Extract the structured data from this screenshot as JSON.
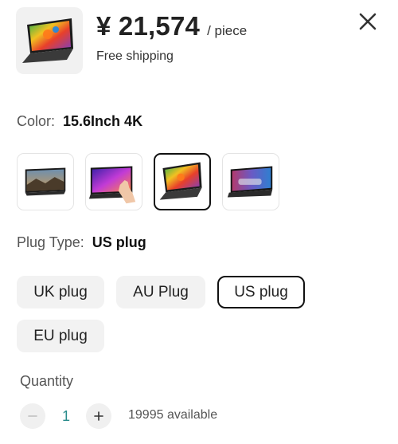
{
  "product": {
    "price": "¥ 21,574",
    "price_unit": "/ piece",
    "shipping": "Free shipping"
  },
  "color_option": {
    "label": "Color:",
    "selected_value": "15.6Inch 4K",
    "swatches": [
      {
        "name": "monitor-game-landscape"
      },
      {
        "name": "monitor-touch-hand"
      },
      {
        "name": "monitor-colorful-parrot"
      },
      {
        "name": "monitor-car-dashboard"
      }
    ],
    "selected_index": 2
  },
  "plug_option": {
    "label": "Plug Type:",
    "selected_value": "US plug",
    "choices": [
      "UK plug",
      "AU Plug",
      "US plug",
      "EU plug"
    ],
    "selected_index": 2
  },
  "quantity": {
    "label": "Quantity",
    "value": "1",
    "available": "19995 available"
  },
  "icons": {
    "close": "close-icon",
    "minus": "minus-icon",
    "plus": "plus-icon"
  },
  "colors": {
    "text": "#222222",
    "selected_border": "#111111",
    "chip_background": "#f2f2f2",
    "quantity_value": "#2a8c8c"
  }
}
